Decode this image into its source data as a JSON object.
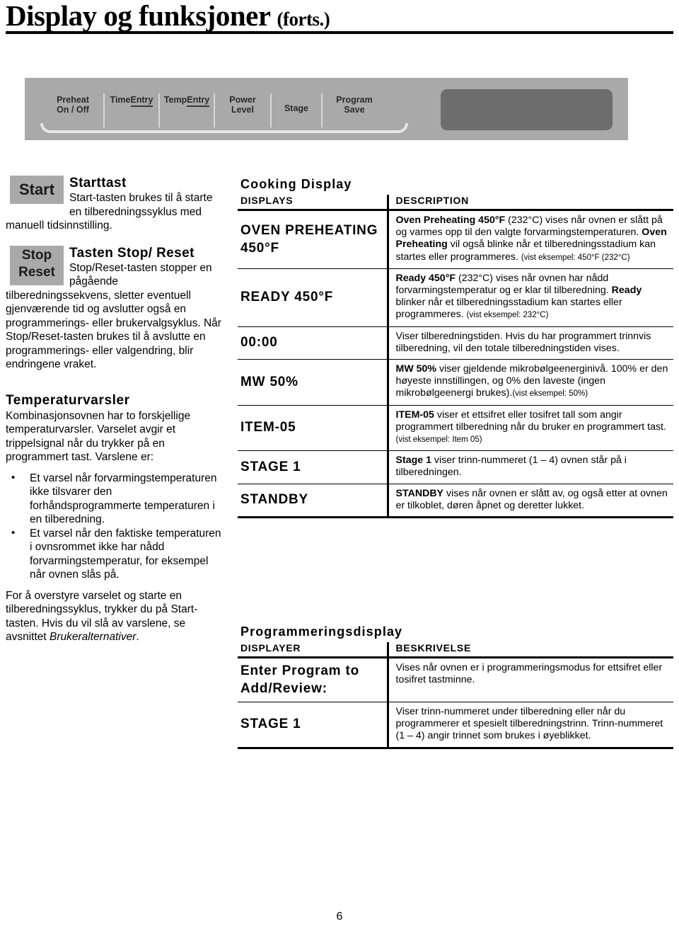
{
  "header": {
    "title": "Display og funksjoner",
    "continued": "(forts.)"
  },
  "control_panel": {
    "buttons": [
      {
        "line1": "Preheat",
        "line2": "On / Off",
        "underline": false
      },
      {
        "line1": "Time",
        "line2": "Entry",
        "underline": true
      },
      {
        "line1": "Temp",
        "line2": "Entry",
        "underline": true
      },
      {
        "line1": "Power",
        "line2": "Level",
        "underline": false
      },
      {
        "line1": "",
        "line2": "Stage",
        "underline": false
      },
      {
        "line1": "Program",
        "line2": "Save",
        "underline": false
      }
    ],
    "display_window_color": "#6d6d6d",
    "panel_color": "#a9a9a9"
  },
  "left_column": {
    "start": {
      "key_label": "Start",
      "heading": "Starttast",
      "body": "Start-tasten brukes til å starte en tilberedningssyklus med manuell tidsinnstilling."
    },
    "stop": {
      "key_label_top": "Stop",
      "key_label_bottom": "Reset",
      "heading": "Tasten Stop/ Reset",
      "body": "Stop/Reset-tasten stopper en pågående tilberedningssekvens, sletter eventuell gjenværende tid og avslutter også en programmerings- eller brukervalgsyklus. Når Stop/Reset-tasten brukes til å avslutte en programmerings- eller valgendring, blir endringene vraket."
    },
    "temperature_alerts": {
      "heading": "Temperaturvarsler",
      "intro": "Kombinasjonsovnen har to forskjellige temperaturvarsler. Varselet avgir et trippelsignal når du trykker på en programmert tast. Varslene er:",
      "bullet_char": "•",
      "bullets": [
        "Et varsel når forvarmingstemperaturen ikke tilsvarer den forhåndsprogrammerte temperaturen i en tilberedning.",
        "Et varsel når den faktiske temperaturen i ovnsrommet ikke har nådd forvarmingstemperatur, for eksempel når ovnen slås på."
      ],
      "closing_text": "For å overstyre varselet og starte en tilberedningssyklus, trykker du på Start-tasten. Hvis du vil slå av varslene, se avsnittet ",
      "closing_italic": "Brukeralternativer",
      "closing_end": "."
    }
  },
  "cooking_table": {
    "caption": "Cooking Display",
    "col1_header": "DISPLAYS",
    "col2_header": "DESCRIPTION",
    "rows": [
      {
        "display": "OVEN PREHEATING 450°F",
        "desc_bold_1": "Oven Preheating 450°F",
        "desc_1": " (232°C) vises når ovnen er slått på og varmes opp til den valgte forvarmingstemperaturen. ",
        "desc_bold_2": "Oven Preheating",
        "desc_2": " vil også blinke når et tilberedningsstadium kan startes eller programmeres. ",
        "desc_small": "(vist eksempel: 450°F (232°C)"
      },
      {
        "display": "READY 450°F",
        "desc_bold_1": "Ready 450°F",
        "desc_1": " (232°C) vises når ovnen har nådd forvarmingstemperatur og er klar til tilberedning. ",
        "desc_bold_2": "Ready",
        "desc_2": " blinker når et tilberedningsstadium kan startes eller programmeres. ",
        "desc_small": "(vist eksempel: 232°C)"
      },
      {
        "display": "00:00",
        "desc_bold_1": "",
        "desc_1": "Viser tilberedningstiden. Hvis du har programmert trinnvis tilberedning, vil den totale tilberedningstiden vises.",
        "desc_bold_2": "",
        "desc_2": "",
        "desc_small": ""
      },
      {
        "display": "MW 50%",
        "desc_bold_1": "MW 50%",
        "desc_1": " viser gjeldende mikrobølgeenerginivå. 100% er den høyeste innstillingen, og 0% den laveste (ingen mikrobølgeenergi brukes).",
        "desc_bold_2": "",
        "desc_2": "",
        "desc_small": "(vist eksempel: 50%)"
      },
      {
        "display": "ITEM-05",
        "desc_bold_1": "ITEM-05",
        "desc_1": " viser et ettsifret eller tosifret tall som angir programmert tilberedning når du bruker en programmert tast. ",
        "desc_bold_2": "",
        "desc_2": "",
        "desc_small": "(vist eksempel: Item 05)"
      },
      {
        "display": "STAGE 1",
        "desc_bold_1": "Stage 1",
        "desc_1": " viser trinn-nummeret (1 – 4) ovnen står på i tilberedningen.",
        "desc_bold_2": "",
        "desc_2": "",
        "desc_small": ""
      },
      {
        "display": "STANDBY",
        "desc_bold_1": "STANDBY",
        "desc_1": " vises når ovnen er slått av, og også etter at ovnen er tilkoblet, døren åpnet og deretter lukket.",
        "desc_bold_2": "",
        "desc_2": "",
        "desc_small": ""
      }
    ]
  },
  "programming_table": {
    "caption": "Programmeringsdisplay",
    "col1_header": "DISPLAYER",
    "col2_header": "BESKRIVELSE",
    "rows": [
      {
        "display": "Enter Program to Add/Review:",
        "desc": "Vises når ovnen er i programmeringsmodus for ettsifret eller tosifret tastminne."
      },
      {
        "display": "STAGE 1",
        "desc": "Viser trinn-nummeret under tilberedning eller når du programmerer et spesielt tilberedningstrinn. Trinn-nummeret (1 – 4) angir trinnet som brukes i øyeblikket."
      }
    ]
  },
  "footer": {
    "page_number": "6"
  }
}
